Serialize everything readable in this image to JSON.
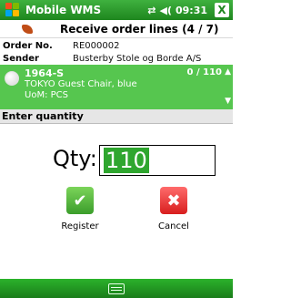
{
  "titlebar": {
    "app_name": "Mobile WMS",
    "signal_icon": "signal-icon",
    "volume_icon": "speaker-icon",
    "time": "09:31",
    "close_icon": "close-icon",
    "close_label": "X"
  },
  "section": {
    "icon": "leaf-icon",
    "title": "Receive order lines (4 / 7)"
  },
  "order": {
    "order_no_label": "Order No.",
    "order_no_value": "RE000002",
    "sender_label": "Sender",
    "sender_value": "Busterby Stole og Borde A/S"
  },
  "line_item": {
    "code": "1964-S",
    "description": "TOKYO Guest Chair, blue",
    "uom": "UoM: PCS",
    "quantity": "0 / 110",
    "scroll_up": "▲",
    "scroll_down": "▼",
    "highlight_color": "#56c64f"
  },
  "enter_quantity": {
    "heading": "Enter quantity",
    "qty_label": "Qty:",
    "qty_value": "110"
  },
  "actions": {
    "register_label": "Register",
    "register_icon": "checkmark-icon",
    "cancel_label": "Cancel",
    "cancel_icon": "cross-icon"
  },
  "bottombar": {
    "keyboard_icon": "keyboard-icon"
  },
  "colors": {
    "accent": "#1e861e",
    "register": "#3b9d2b",
    "cancel": "#d81e1e"
  }
}
